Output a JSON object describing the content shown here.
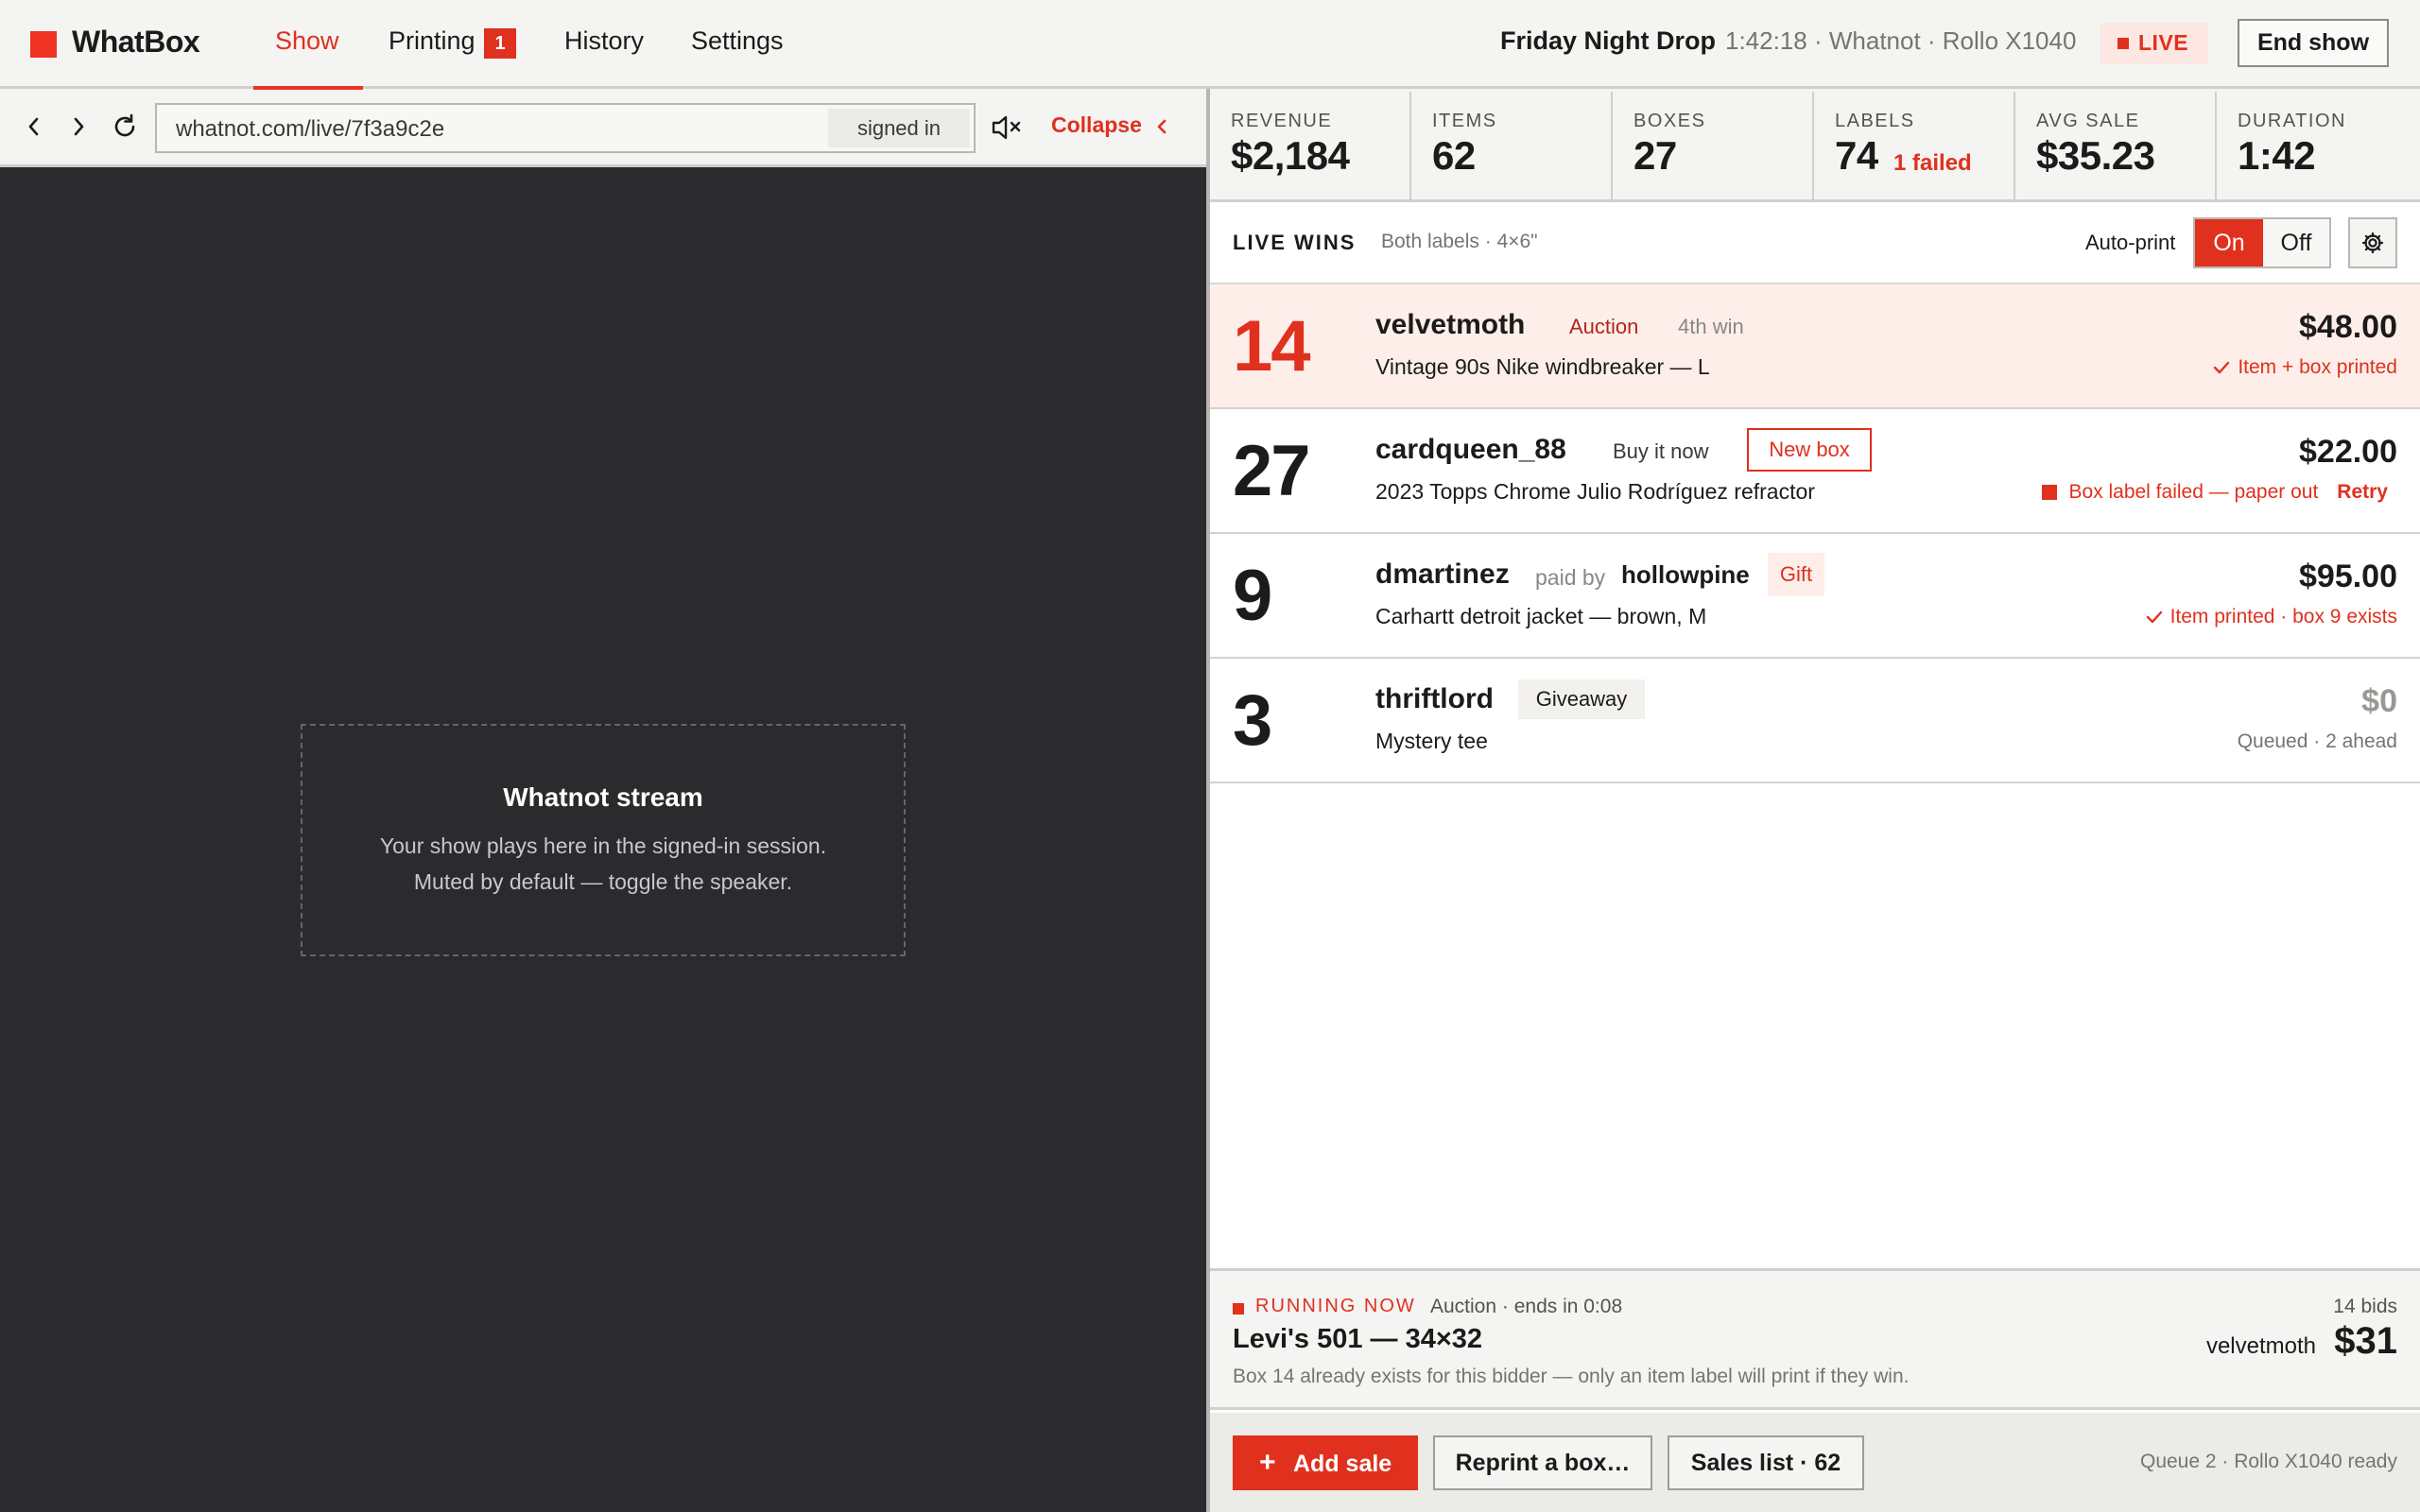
{
  "app": {
    "name": "WhatBox"
  },
  "nav": {
    "items": [
      {
        "label": "Show",
        "active": true
      },
      {
        "label": "Printing",
        "badge": "1"
      },
      {
        "label": "History"
      },
      {
        "label": "Settings"
      }
    ]
  },
  "show": {
    "title": "Friday Night Drop",
    "meta": "1:42:18 · Whatnot · Rollo X1040",
    "live": "LIVE",
    "end_label": "End show"
  },
  "browser": {
    "url": "whatnot.com/live/7f3a9c2e",
    "session": "signed in",
    "collapse": "Collapse"
  },
  "stream": {
    "title": "Whatnot stream",
    "line1": "Your show plays here in the signed-in session.",
    "line2": "Muted by default — toggle the speaker."
  },
  "stats": [
    {
      "label": "REVENUE",
      "value": "$2,184"
    },
    {
      "label": "ITEMS",
      "value": "62"
    },
    {
      "label": "BOXES",
      "value": "27"
    },
    {
      "label": "LABELS",
      "value": "74",
      "sub": "1 failed"
    },
    {
      "label": "AVG SALE",
      "value": "$35.23"
    },
    {
      "label": "DURATION",
      "value": "1:42"
    }
  ],
  "wins": {
    "title": "LIVE WINS",
    "subtitle": "Both labels · 4×6\"",
    "autoprint_label": "Auto-print",
    "on": "On",
    "off": "Off",
    "rows": [
      {
        "box": "14",
        "bidder": "velvetmoth",
        "type": "Auction",
        "extra": "4th win",
        "item": "Vintage 90s Nike windbreaker — L",
        "price": "$48.00",
        "status": "Item + box printed"
      },
      {
        "box": "27",
        "bidder": "cardqueen_88",
        "type": "Buy it now",
        "extra": "New box",
        "item": "2023 Topps Chrome Julio Rodríguez refractor",
        "price": "$22.00",
        "status": "Box label failed — paper out",
        "action": "Retry"
      },
      {
        "box": "9",
        "bidder": "dmartinez",
        "paid_by": "paid by",
        "payer": "hollowpine",
        "extra": "Gift",
        "item": "Carhartt detroit jacket — brown, M",
        "price": "$95.00",
        "status": "Item printed · box 9 exists"
      },
      {
        "box": "3",
        "bidder": "thriftlord",
        "type": "Giveaway",
        "item": "Mystery tee",
        "price": "$0",
        "status": "Queued · 2 ahead"
      }
    ]
  },
  "running": {
    "label": "RUNNING NOW",
    "meta": "Auction · ends in 0:08",
    "bids": "14 bids",
    "item": "Levi's 501 — 34×32",
    "bidder": "velvetmoth",
    "price": "$31",
    "note": "Box 14 already exists for this bidder — only an item label will print if they win."
  },
  "footer": {
    "add": "Add sale",
    "reprint": "Reprint a box…",
    "sales": "Sales list · 62",
    "status": "Queue 2 · Rollo X1040 ready"
  },
  "colors": {
    "accent": "#e0301e",
    "stream_bg": "#2b2a2c"
  }
}
